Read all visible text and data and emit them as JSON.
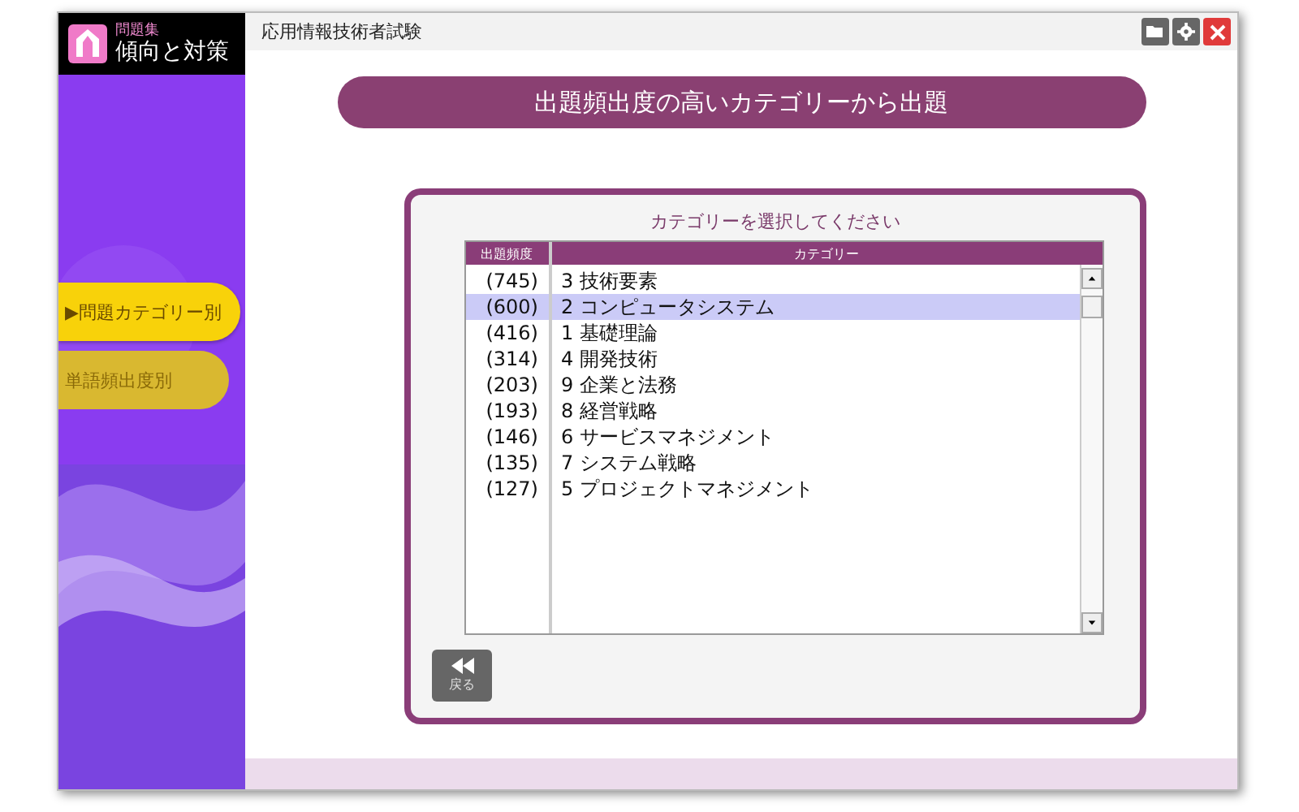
{
  "logo": {
    "subtitle": "問題集",
    "title": "傾向と対策"
  },
  "window": {
    "title": "応用情報技術者試験"
  },
  "sidebar": {
    "items": [
      {
        "label": "▶問題カテゴリー別",
        "selected": true,
        "disabled": false
      },
      {
        "label": "単語頻出度別",
        "selected": false,
        "disabled": true
      }
    ]
  },
  "banner": "出題頻出度の高いカテゴリーから出題",
  "panel": {
    "title": "カテゴリーを選択してください",
    "table": {
      "columns": [
        "出題頻度",
        "カテゴリー"
      ],
      "rows": [
        {
          "count": "(745)",
          "category": "3 技術要素",
          "selected": false
        },
        {
          "count": "(600)",
          "category": "2 コンピュータシステム",
          "selected": true
        },
        {
          "count": "(416)",
          "category": "1 基礎理論",
          "selected": false
        },
        {
          "count": "(314)",
          "category": "4 開発技術",
          "selected": false
        },
        {
          "count": "(203)",
          "category": "9 企業と法務",
          "selected": false
        },
        {
          "count": "(193)",
          "category": "8 経営戦略",
          "selected": false
        },
        {
          "count": "(146)",
          "category": "6 サービスマネジメント",
          "selected": false
        },
        {
          "count": "(135)",
          "category": "7 システム戦略",
          "selected": false
        },
        {
          "count": "(127)",
          "category": "5 プロジェクトマネジメント",
          "selected": false
        }
      ]
    },
    "back_button": "戻る"
  }
}
